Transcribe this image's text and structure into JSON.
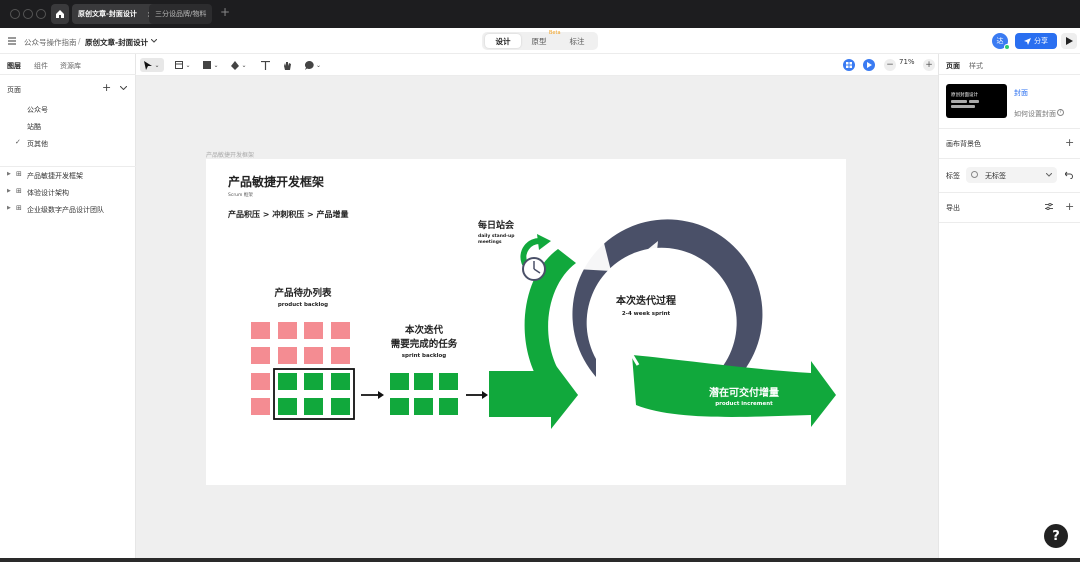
{
  "tabs": [
    {
      "label": "原创文章-封面设计",
      "active": true
    },
    {
      "label": "三分设品牌/物料",
      "active": false
    }
  ],
  "breadcrumb": {
    "project": "公众号操作指南",
    "separator": "/",
    "file": "原创文章-封面设计"
  },
  "modes": {
    "design": "设计",
    "prototype": "原型",
    "beta": "Beta",
    "annotate": "标注"
  },
  "user": {
    "avatar_text": "达"
  },
  "share_label": "分享",
  "left_panel": {
    "tabs": [
      "图层",
      "组件",
      "资源库"
    ],
    "pages_header": "页面",
    "pages": [
      {
        "label": "公众号",
        "checked": false
      },
      {
        "label": "站酷",
        "checked": false
      },
      {
        "label": "页其他",
        "checked": true
      }
    ],
    "layers": [
      "产品敏捷开发框架",
      "体验设计架构",
      "企业级数字产品设计团队"
    ]
  },
  "toolbar": {
    "zoom": "71%"
  },
  "canvas": {
    "frame_label": "产品敏捷开发框架"
  },
  "diagram": {
    "title": "产品敏捷开发框架",
    "subtitle": "Scrum 框架",
    "flow": "产品积压 > 冲刺积压 > 产品增量",
    "backlog_cn": "产品待办列表",
    "backlog_en": "product backlog",
    "sprint_cn_1": "本次迭代",
    "sprint_cn_2": "需要完成的任务",
    "sprint_en": "sprint backlog",
    "daily_cn": "每日站会",
    "daily_en_1": "daily stand-up",
    "daily_en_2": "meetings",
    "iteration_cn": "本次迭代过程",
    "iteration_en": "2-4 week sprint",
    "increment_cn": "潜在可交付增量",
    "increment_en": "product increment",
    "colors": {
      "pink": "#f48c92",
      "green": "#11a83c",
      "slate": "#4a5068",
      "black": "#111111"
    }
  },
  "right_panel": {
    "tabs": [
      "页面",
      "样式"
    ],
    "cover_thumb_title": "原创封面设计",
    "cover_label": "封面",
    "cover_help": "如何设置封面",
    "canvas_bg": "画布背景色",
    "tag_label": "标签",
    "tag_value": "无标签",
    "export_label": "导出"
  },
  "help_label": "?"
}
